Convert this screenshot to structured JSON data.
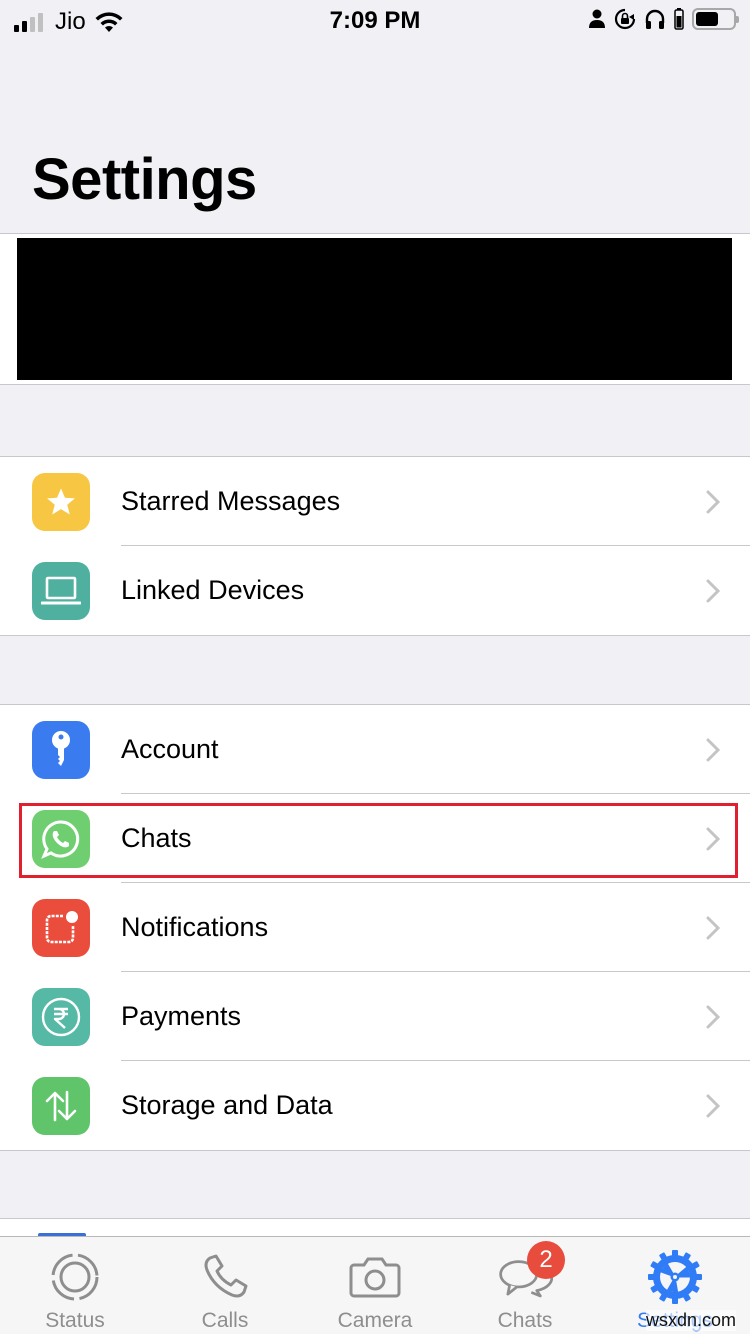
{
  "status_bar": {
    "carrier": "Jio",
    "time": "7:09 PM",
    "signal_bars_active": 2,
    "signal_bars_total": 4,
    "icons": [
      "signal-icon",
      "wifi-icon",
      "person-icon",
      "rotation-lock-icon",
      "headphones-icon",
      "headphone-battery-icon",
      "battery-icon"
    ]
  },
  "header": {
    "title": "Settings"
  },
  "profile": {
    "redacted": true
  },
  "groups": [
    {
      "items": [
        {
          "label": "Starred Messages",
          "icon": "star-icon",
          "color": "#f7c744"
        },
        {
          "label": "Linked Devices",
          "icon": "laptop-icon",
          "color": "#4fb09f"
        }
      ]
    },
    {
      "items": [
        {
          "label": "Account",
          "icon": "key-icon",
          "color": "#3a7cf0"
        },
        {
          "label": "Chats",
          "icon": "whatsapp-icon",
          "color": "#6fcf70",
          "highlighted": true
        },
        {
          "label": "Notifications",
          "icon": "notification-icon",
          "color": "#eb4d3d"
        },
        {
          "label": "Payments",
          "icon": "rupee-icon",
          "color": "#56b9a5"
        },
        {
          "label": "Storage and Data",
          "icon": "arrows-updown-icon",
          "color": "#5fc46a"
        }
      ]
    }
  ],
  "highlight_color": "#e0202e",
  "tabbar": {
    "tabs": [
      {
        "label": "Status",
        "icon": "status-icon",
        "active": false
      },
      {
        "label": "Calls",
        "icon": "phone-icon",
        "active": false
      },
      {
        "label": "Camera",
        "icon": "camera-icon",
        "active": false
      },
      {
        "label": "Chats",
        "icon": "chat-bubbles-icon",
        "active": false,
        "badge": "2"
      },
      {
        "label": "Settings",
        "icon": "settings-gear-icon",
        "active": true
      }
    ],
    "active_color": "#2f7cf6",
    "inactive_color": "#8e8e8e",
    "badge_color": "#e74c3c"
  },
  "watermark": "wsxdn.com"
}
